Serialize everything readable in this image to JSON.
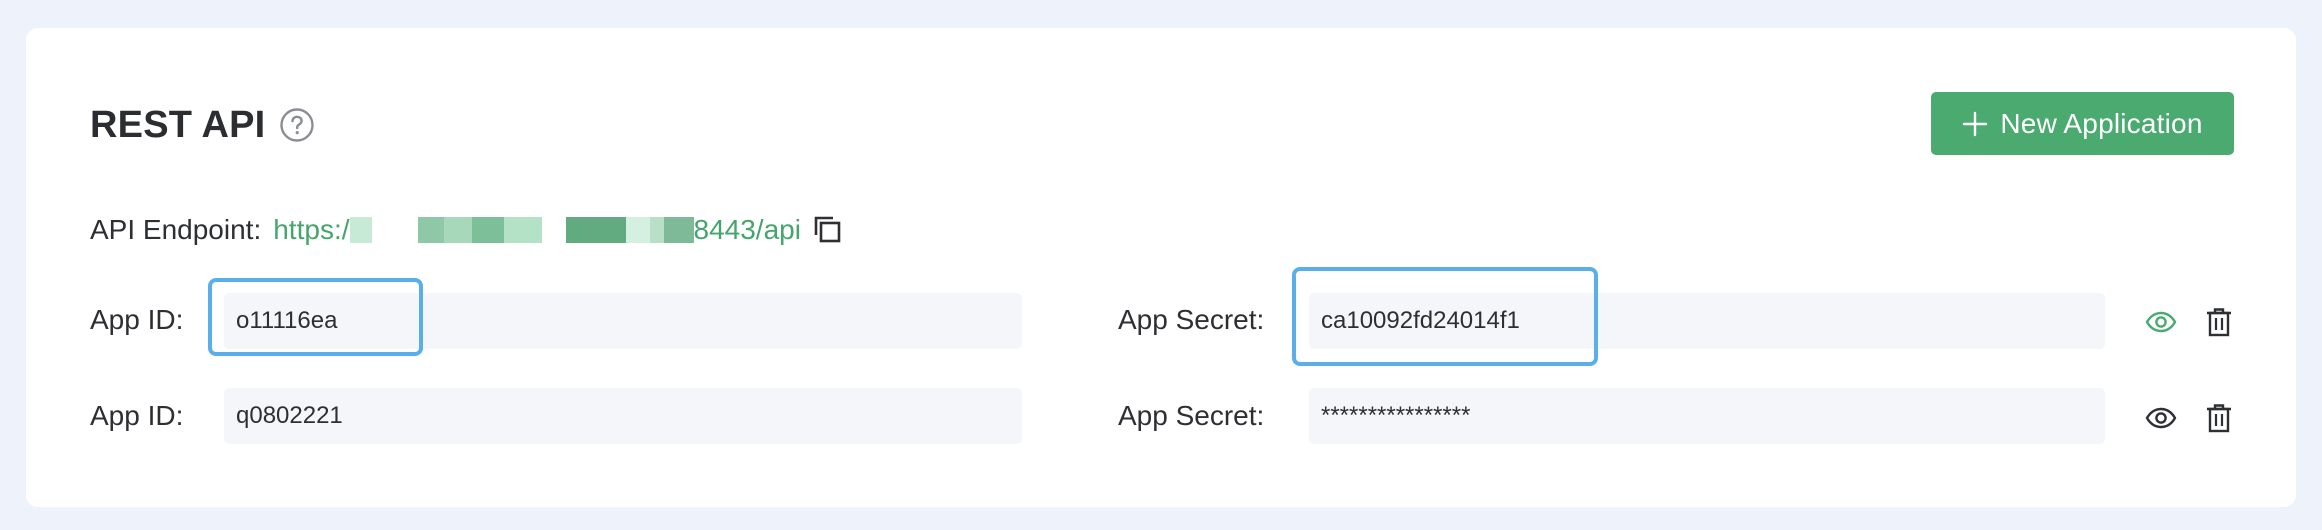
{
  "section": {
    "title": "REST API",
    "help_icon": "question-circle-icon",
    "new_button_label": "New Application",
    "new_button_icon": "plus-icon",
    "accent_color": "#4aaa70",
    "highlight_color": "#5aaeea"
  },
  "endpoint": {
    "label": "API Endpoint:",
    "url_prefix": "https:/",
    "url_suffix": "8443/api",
    "copy_icon": "copy-icon"
  },
  "apps": [
    {
      "id_label": "App ID:",
      "id_value": "o11116ea",
      "secret_label": "App Secret:",
      "secret_value": "ca10092fd24014f1",
      "secret_visible": true,
      "visibility_icon": "eye-icon",
      "delete_icon": "trash-icon"
    },
    {
      "id_label": "App ID:",
      "id_value": "q0802221",
      "secret_label": "App Secret:",
      "secret_value": "****************",
      "secret_visible": false,
      "visibility_icon": "eye-icon",
      "delete_icon": "trash-icon"
    }
  ]
}
